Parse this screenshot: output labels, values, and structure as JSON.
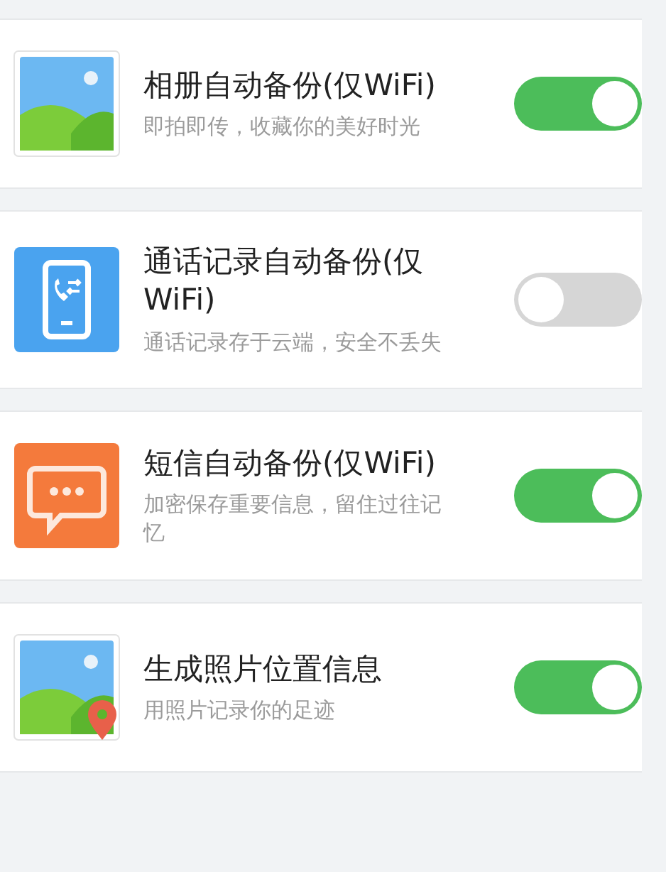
{
  "settings": [
    {
      "kind": "album",
      "title": "相册自动备份(仅WiFi)",
      "subtitle": "即拍即传，收藏你的美好时光",
      "on": true
    },
    {
      "kind": "calls",
      "title": "通话记录自动备份(仅WiFi)",
      "subtitle": "通话记录存于云端，安全不丢失",
      "on": false
    },
    {
      "kind": "sms",
      "title": "短信自动备份(仅WiFi)",
      "subtitle": "加密保存重要信息，留住过往记忆",
      "on": true
    },
    {
      "kind": "photo-location",
      "title": "生成照片位置信息",
      "subtitle": "用照片记录你的足迹",
      "on": true
    }
  ]
}
